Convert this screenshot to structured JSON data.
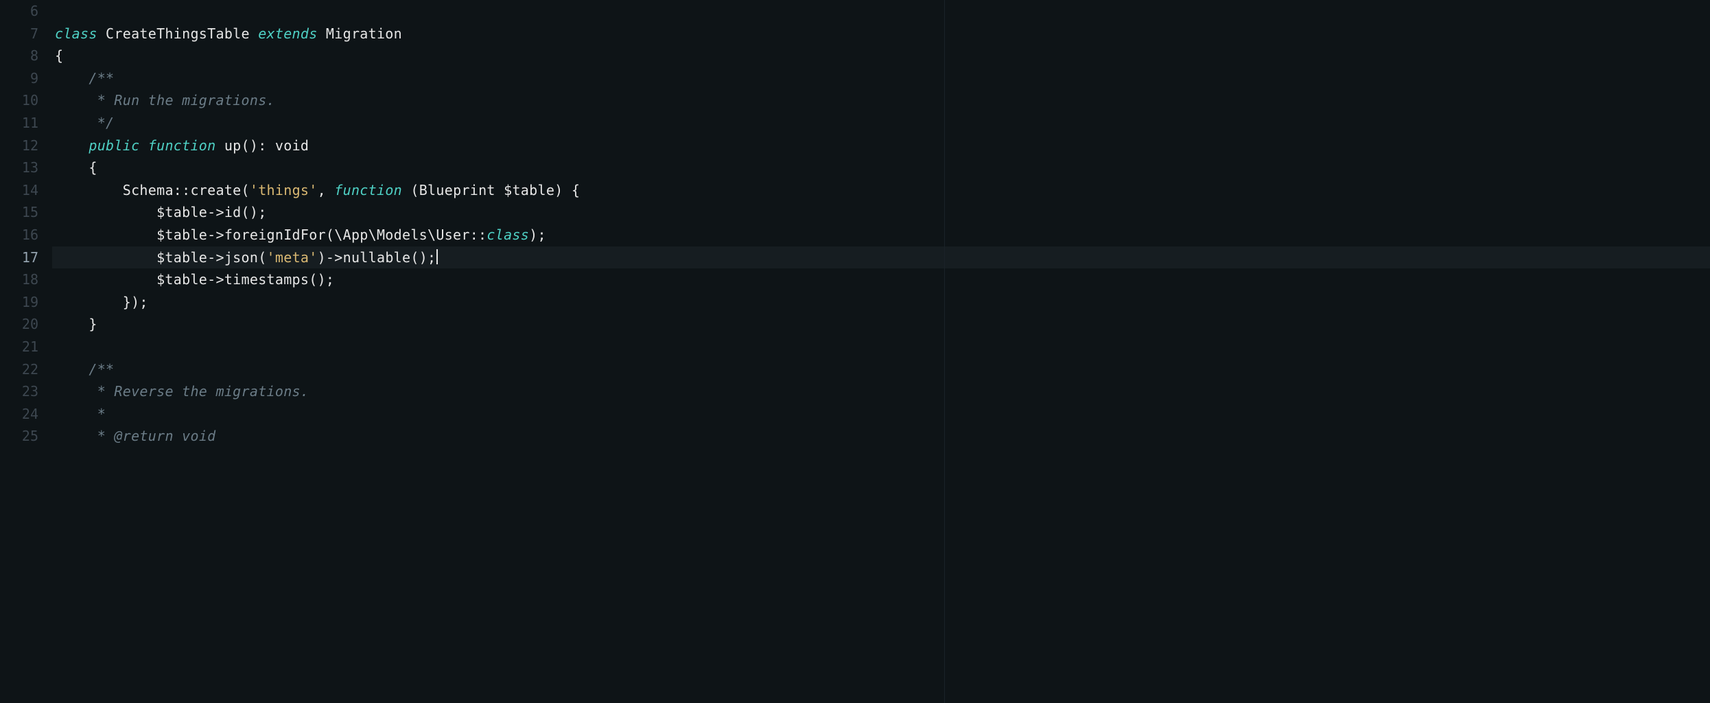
{
  "editor": {
    "highlighted_line": 17,
    "lines": [
      {
        "num": 6,
        "indent": 0,
        "tokens": []
      },
      {
        "num": 7,
        "indent": 0,
        "tokens": [
          {
            "t": "class ",
            "c": "keyword"
          },
          {
            "t": "CreateThingsTable ",
            "c": "class"
          },
          {
            "t": "extends ",
            "c": "keyword"
          },
          {
            "t": "Migration",
            "c": "class"
          }
        ]
      },
      {
        "num": 8,
        "indent": 0,
        "tokens": [
          {
            "t": "{",
            "c": "punct"
          }
        ]
      },
      {
        "num": 9,
        "indent": 1,
        "tokens": [
          {
            "t": "/**",
            "c": "doc"
          }
        ]
      },
      {
        "num": 10,
        "indent": 1,
        "tokens": [
          {
            "t": " * Run the migrations.",
            "c": "doc"
          }
        ]
      },
      {
        "num": 11,
        "indent": 1,
        "tokens": [
          {
            "t": " */",
            "c": "doc"
          }
        ]
      },
      {
        "num": 12,
        "indent": 1,
        "tokens": [
          {
            "t": "public ",
            "c": "keyword"
          },
          {
            "t": "function ",
            "c": "keyword"
          },
          {
            "t": "up",
            "c": "defname"
          },
          {
            "t": "(): ",
            "c": "punct"
          },
          {
            "t": "void",
            "c": "type"
          }
        ]
      },
      {
        "num": 13,
        "indent": 1,
        "tokens": [
          {
            "t": "{",
            "c": "punct"
          }
        ]
      },
      {
        "num": 14,
        "indent": 2,
        "tokens": [
          {
            "t": "Schema::",
            "c": "var"
          },
          {
            "t": "create",
            "c": "func"
          },
          {
            "t": "(",
            "c": "punct"
          },
          {
            "t": "'things'",
            "c": "string"
          },
          {
            "t": ", ",
            "c": "punct"
          },
          {
            "t": "function ",
            "c": "keyword"
          },
          {
            "t": "(Blueprint $table) {",
            "c": "punct"
          }
        ]
      },
      {
        "num": 15,
        "indent": 3,
        "tokens": [
          {
            "t": "$table->",
            "c": "var"
          },
          {
            "t": "id",
            "c": "func"
          },
          {
            "t": "();",
            "c": "punct"
          }
        ]
      },
      {
        "num": 16,
        "indent": 3,
        "tokens": [
          {
            "t": "$table->",
            "c": "var"
          },
          {
            "t": "foreignIdFor",
            "c": "func"
          },
          {
            "t": "(\\App\\Models\\User::",
            "c": "punct"
          },
          {
            "t": "class",
            "c": "classconst"
          },
          {
            "t": ");",
            "c": "punct"
          }
        ]
      },
      {
        "num": 17,
        "indent": 3,
        "tokens": [
          {
            "t": "$table->",
            "c": "var"
          },
          {
            "t": "json",
            "c": "func"
          },
          {
            "t": "(",
            "c": "punct"
          },
          {
            "t": "'meta'",
            "c": "string"
          },
          {
            "t": ")->",
            "c": "punct"
          },
          {
            "t": "nullable",
            "c": "func"
          },
          {
            "t": "();",
            "c": "punct"
          }
        ]
      },
      {
        "num": 18,
        "indent": 3,
        "tokens": [
          {
            "t": "$table->",
            "c": "var"
          },
          {
            "t": "timestamps",
            "c": "func"
          },
          {
            "t": "();",
            "c": "punct"
          }
        ]
      },
      {
        "num": 19,
        "indent": 2,
        "tokens": [
          {
            "t": "});",
            "c": "punct"
          }
        ]
      },
      {
        "num": 20,
        "indent": 1,
        "tokens": [
          {
            "t": "}",
            "c": "punct"
          }
        ]
      },
      {
        "num": 21,
        "indent": 0,
        "tokens": []
      },
      {
        "num": 22,
        "indent": 1,
        "tokens": [
          {
            "t": "/**",
            "c": "doc"
          }
        ]
      },
      {
        "num": 23,
        "indent": 1,
        "tokens": [
          {
            "t": " * Reverse the migrations.",
            "c": "doc"
          }
        ]
      },
      {
        "num": 24,
        "indent": 1,
        "tokens": [
          {
            "t": " *",
            "c": "doc"
          }
        ]
      },
      {
        "num": 25,
        "indent": 1,
        "tokens": [
          {
            "t": " * ",
            "c": "doc"
          },
          {
            "t": "@return ",
            "c": "tag"
          },
          {
            "t": "void",
            "c": "rettype"
          }
        ]
      }
    ],
    "indent_unit": "    ",
    "cursor_line": 17
  }
}
